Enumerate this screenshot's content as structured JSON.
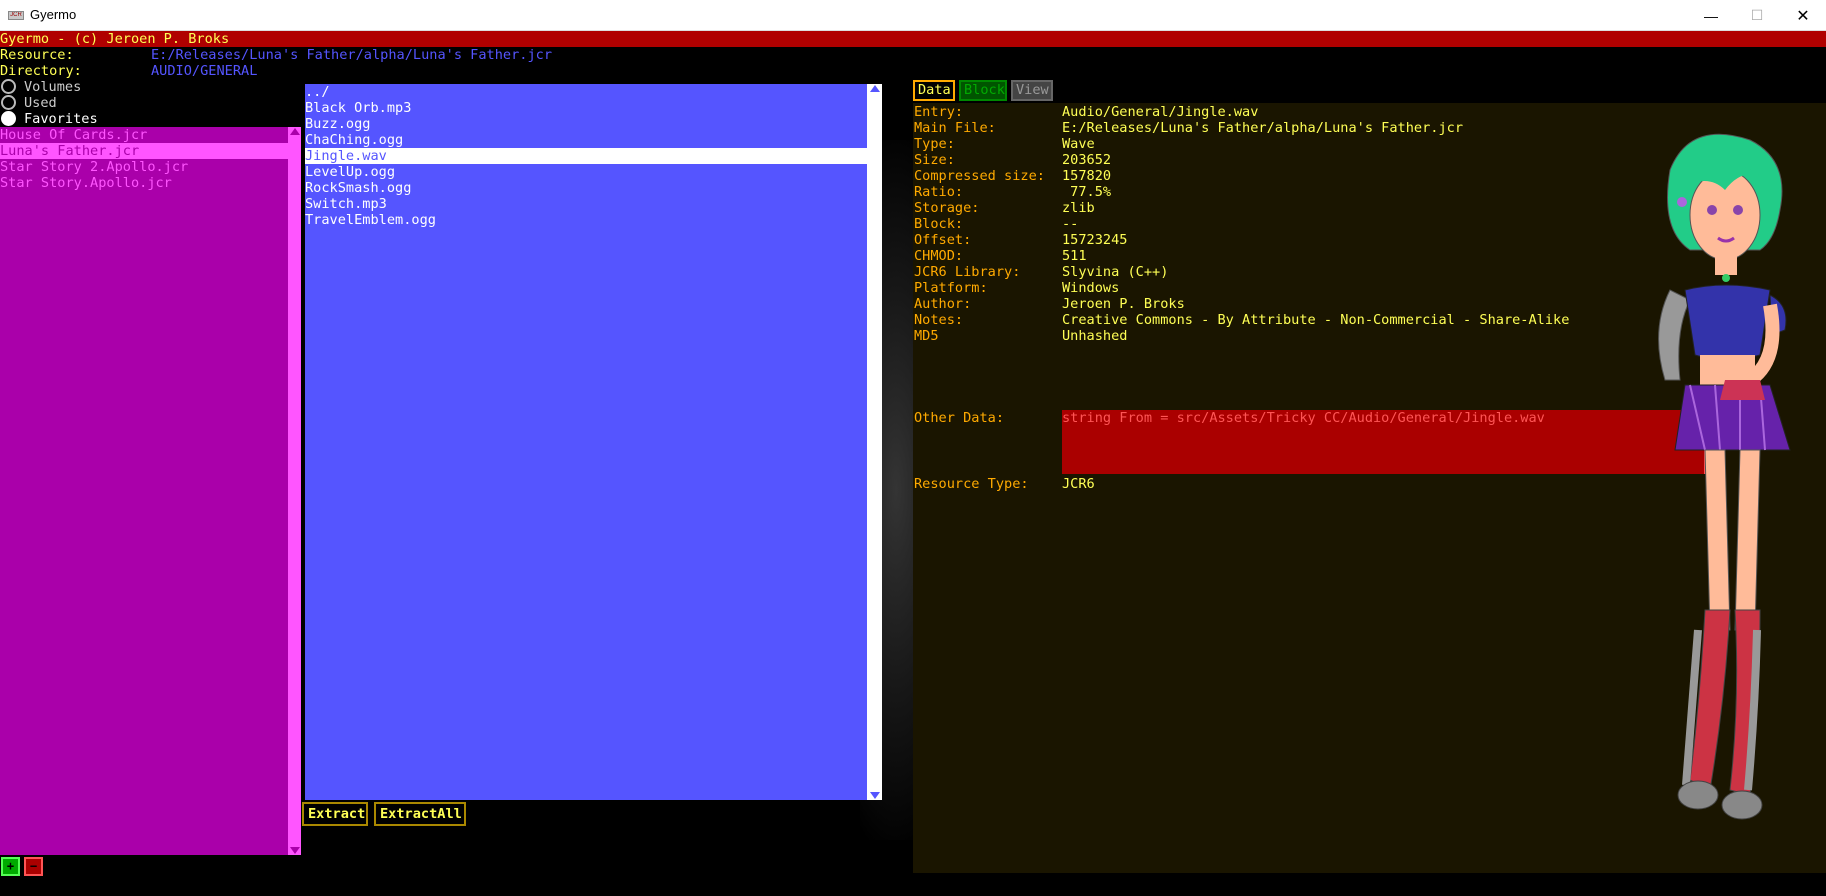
{
  "window": {
    "title": "Gyermo",
    "logo_text": "JCR",
    "minimize": "—",
    "maximize": "☐",
    "close": "✕"
  },
  "header": {
    "text": "Gyermo - (c) Jeroen P. Broks"
  },
  "resource": {
    "label": "Resource:",
    "value": "E:/Releases/Luna's Father/alpha/Luna's Father.jcr"
  },
  "directory": {
    "label": "Directory:",
    "value": "AUDIO/GENERAL"
  },
  "radios": [
    {
      "label": "Volumes",
      "selected": false
    },
    {
      "label": "Used",
      "selected": false
    },
    {
      "label": "Favorites",
      "selected": true
    }
  ],
  "left_files": [
    {
      "name": "House Of Cards.jcr",
      "selected": false
    },
    {
      "name": "Luna's Father.jcr",
      "selected": true
    },
    {
      "name": "Star Story 2.Apollo.jcr",
      "selected": false
    },
    {
      "name": "Star Story.Apollo.jcr",
      "selected": false
    }
  ],
  "entries": [
    {
      "name": "../",
      "selected": false
    },
    {
      "name": "Black Orb.mp3",
      "selected": false
    },
    {
      "name": "Buzz.ogg",
      "selected": false
    },
    {
      "name": "ChaChing.ogg",
      "selected": false
    },
    {
      "name": "Jingle.wav",
      "selected": true
    },
    {
      "name": "LevelUp.ogg",
      "selected": false
    },
    {
      "name": "RockSmash.ogg",
      "selected": false
    },
    {
      "name": "Switch.mp3",
      "selected": false
    },
    {
      "name": "TravelEmblem.ogg",
      "selected": false
    }
  ],
  "buttons": {
    "extract": "Extract",
    "extract_all": "ExtractAll",
    "add": "+",
    "remove": "−"
  },
  "tabs": {
    "data": "Data",
    "block": "Block",
    "view": "View"
  },
  "info": [
    {
      "label": "Entry:",
      "value": "Audio/General/Jingle.wav"
    },
    {
      "label": "Main File:",
      "value": "E:/Releases/Luna's Father/alpha/Luna's Father.jcr"
    },
    {
      "label": "Type:",
      "value": "Wave"
    },
    {
      "label": "Size:",
      "value": "203652"
    },
    {
      "label": "Compressed size:",
      "value": "157820"
    },
    {
      "label": "Ratio:",
      "value": " 77.5%"
    },
    {
      "label": "Storage:",
      "value": "zlib"
    },
    {
      "label": "Block:",
      "value": "--"
    },
    {
      "label": "Offset:",
      "value": "15723245"
    },
    {
      "label": "CHMOD:",
      "value": "511"
    },
    {
      "label": "JCR6 Library:",
      "value": "Slyvina (C++)"
    },
    {
      "label": "Platform:",
      "value": "Windows"
    },
    {
      "label": "Author:",
      "value": "Jeroen P. Broks"
    },
    {
      "label": "Notes:",
      "value": "Creative Commons - By Attribute - Non-Commercial - Share-Alike"
    },
    {
      "label": "MD5",
      "value": "Unhashed"
    }
  ],
  "other_data": {
    "label": "Other Data:",
    "value": "string From = src/Assets/Tricky CC/Audio/General/Jingle.wav"
  },
  "resource_type": {
    "label": "Resource Type:",
    "value": "JCR6"
  },
  "colors": {
    "header_bar": "#b00000",
    "left_list": "#aa00aa",
    "left_highlight": "#ff55ff",
    "mid_list": "#5555ff",
    "label_yellow": "#ffff55",
    "info_label": "#ffaa00",
    "other_box": "#aa0000"
  }
}
